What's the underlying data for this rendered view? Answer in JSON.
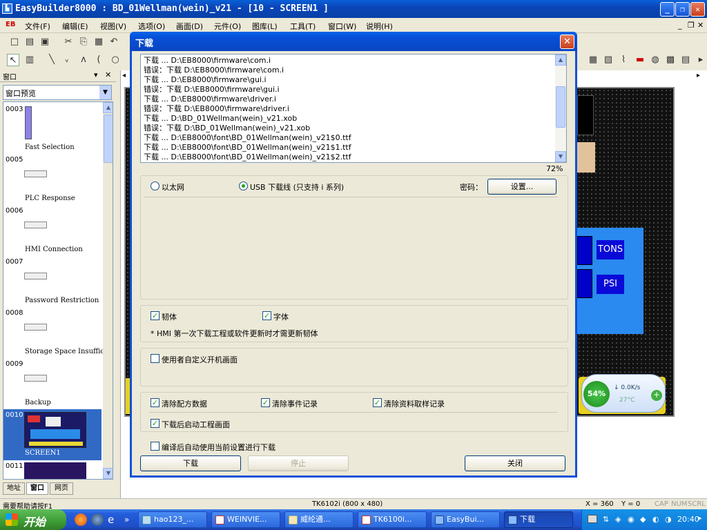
{
  "app": {
    "title": "EasyBuilder8000 : BD_01Wellman(wein)_v21 - [10 - SCREEN1 ]",
    "logo": "EB",
    "window_buttons": {
      "minimize": "_",
      "restore": "❐",
      "close": "✕"
    },
    "mdi_buttons": {
      "minimize": "_",
      "restore": "❐",
      "close": "✕"
    }
  },
  "menu": [
    "文件(F)",
    "编辑(E)",
    "视图(V)",
    "选项(O)",
    "画面(D)",
    "元件(O)",
    "图库(L)",
    "工具(T)",
    "窗口(W)",
    "说明(H)"
  ],
  "left_panel": {
    "header": "窗口",
    "preview_select": "窗口预览",
    "items": [
      {
        "num": "0003",
        "label": "Fast Selection"
      },
      {
        "num": "0005",
        "label": "PLC Response"
      },
      {
        "num": "0006",
        "label": "HMI Connection"
      },
      {
        "num": "0007",
        "label": "Password Restriction"
      },
      {
        "num": "0008",
        "label": "Storage Space Insufficie"
      },
      {
        "num": "0009",
        "label": "Backup"
      },
      {
        "num": "0010",
        "label": "SCREEN1"
      },
      {
        "num": "0011",
        "label": ""
      }
    ],
    "tabs": [
      "地址",
      "窗口",
      "网页"
    ],
    "active_tab": "窗口"
  },
  "canvas": {
    "labels": [
      "TONS",
      "PSI"
    ],
    "net_widget": {
      "percent": "54%",
      "speed": "0.0K/s",
      "temp": "27°C"
    }
  },
  "status_bar": {
    "help": "需要帮助请按F1",
    "model": "TK6102i (800 x 480)",
    "x": "X = 360",
    "y": "Y = 0",
    "indicators": [
      "CAP",
      "NUM",
      "SCRL"
    ]
  },
  "taskbar": {
    "start": "开始",
    "tasks": [
      "hao123_...",
      "WEINVIE...",
      "威纶通...",
      "TK6100i...",
      "EasyBui...",
      "下载"
    ],
    "active_task": "下载",
    "clock": "20:40"
  },
  "dialog": {
    "title": "下载",
    "log_lines": [
      "下载 ... D:\\EB8000\\firmware\\com.i",
      "错误：下载 D:\\EB8000\\firmware\\com.i",
      "下载 ... D:\\EB8000\\firmware\\gui.i",
      "错误：下载 D:\\EB8000\\firmware\\gui.i",
      "下载 ... D:\\EB8000\\firmware\\driver.i",
      "错误：下载 D:\\EB8000\\firmware\\driver.i",
      "下载 ... D:\\BD_01Wellman(wein)_v21.xob",
      "错误：下载 D:\\BD_01Wellman(wein)_v21.xob",
      "下载 ... D:\\EB8000\\font\\BD_01Wellman(wein)_v21$0.ttf",
      "下载 ... D:\\EB8000\\font\\BD_01Wellman(wein)_v21$1.ttf",
      "下载 ... D:\\EB8000\\font\\BD_01Wellman(wein)_v21$2.ttf"
    ],
    "progress": "72%",
    "radio_ethernet": "以太网",
    "radio_usb": "USB 下载线 (只支持 i 系列)",
    "password_label": "密码：",
    "settings_button": "设置...",
    "firmware_label": "韧体",
    "font_label": "字体",
    "note": "* HMI 第一次下载工程或软件更新时才需更新韧体",
    "custom_boot_label": "使用者自定义开机画面",
    "clear_recipe_label": "清除配方数据",
    "clear_event_label": "清除事件记录",
    "clear_sampling_label": "清除资料取样记录",
    "start_after_label": "下载后启动工程画面",
    "auto_download_label": "编译后自动使用当前设置进行下载",
    "download_button": "下载",
    "stop_button": "停止",
    "close_button": "关闭",
    "checked": {
      "firmware": true,
      "font": true,
      "custom_boot": false,
      "clear_recipe": true,
      "clear_event": true,
      "clear_sampling": true,
      "start_after": true,
      "auto_download": false
    }
  }
}
